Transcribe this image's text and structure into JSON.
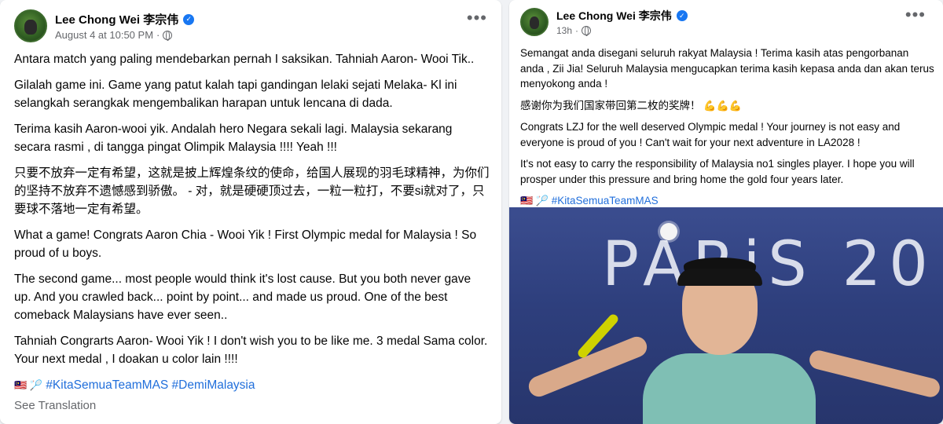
{
  "left_post": {
    "author": "Lee Chong Wei 李宗伟",
    "timestamp": "August 4 at 10:50 PM",
    "more_label": "•••",
    "paragraphs": [
      "Antara match yang paling mendebarkan pernah I saksikan. Tahniah Aaron- Wooi Tik..",
      "Gilalah game ini. Game yang patut kalah tapi gandingan lelaki sejati Melaka- Kl ini selangkah serangkak mengembalikan harapan untuk lencana di dada.",
      "Terima kasih Aaron-wooi yik. Andalah hero Negara sekali lagi. Malaysia sekarang secara rasmi , di tangga pingat Olimpik Malaysia !!!! Yeah !!!",
      "只要不放弃一定有希望，这就是披上辉煌条纹的使命，给国人展现的羽毛球精神，为你们的坚持不放弃不遗憾感到骄傲。 - 对，就是硬硬顶过去，一粒一粒打，不要si就对了，只要球不落地一定有希望。",
      "What a game! Congrats Aaron Chia - Wooi Yik ! First Olympic medal for Malaysia ! So proud of u boys.",
      "The second game... most people would think it's lost cause. But you both never gave up. And you crawled back... point by point... and made us proud. One of the best comeback Malaysians have ever seen..",
      "Tahniah Congrarts Aaron- Wooi Yik ! I don't wish you to be like me. 3 medal Sama color. Your next medal , I doakan u color lain !!!!"
    ],
    "emoji_prefix": "🇲🇾 🏸",
    "hashtags": "#KitaSemuaTeamMAS #DemiMalaysia",
    "see_translation": "See Translation"
  },
  "right_post": {
    "author": "Lee Chong Wei 李宗伟",
    "timestamp": "13h",
    "more_label": "•••",
    "paragraphs": [
      "Semangat anda disegani seluruh rakyat Malaysia ! Terima kasih atas pengorbanan anda , Zii Jia! Seluruh Malaysia mengucapkan terima kasih kepasa anda dan akan terus menyokong anda !",
      "感谢你为我们国家带回第二枚的奖牌！",
      "Congrats LZJ for the well deserved Olympic medal ! Your journey is not easy and everyone is proud of you ! Can't wait for your next adventure in LA2028 !",
      "It's not easy to carry the responsibility of Malaysia no1 singles player. I hope you will prosper under this pressure and bring home the gold four years later."
    ],
    "flex_emoji": "💪💪💪",
    "emoji_prefix": "🇲🇾 🏸",
    "hashtags": "#KitaSemuaTeamMAS",
    "photo_text": "PARiS 20"
  }
}
